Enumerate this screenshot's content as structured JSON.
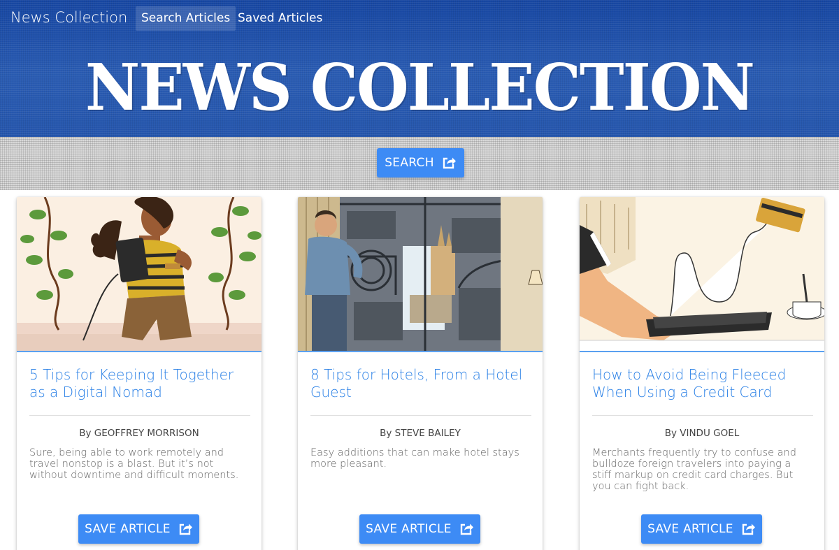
{
  "navbar": {
    "brand": "News Collection",
    "links": [
      {
        "label": "Search Articles",
        "active": true
      },
      {
        "label": "Saved Articles",
        "active": false
      }
    ]
  },
  "hero": {
    "title": "NEWS COLLECTION"
  },
  "search": {
    "button_label": "SEARCH",
    "icon": "share-square-icon"
  },
  "articles": [
    {
      "title": "5 Tips for Keeping It Together as a Digital Nomad",
      "author": "By GEOFFREY MORRISON",
      "summary": "Sure, being able to work remotely and travel nonstop is a blast. But it’s not without downtime and difficult moments.",
      "save_label": "SAVE ARTICLE",
      "image": "illustration-woman-with-vines"
    },
    {
      "title": "8 Tips for Hotels, From a Hotel Guest",
      "author": "By STEVE BAILEY",
      "summary": "Easy additions that can make hotel stays more pleasant.",
      "save_label": "SAVE ARTICLE",
      "image": "illustration-man-opening-curtain"
    },
    {
      "title": "How to Avoid Being Fleeced When Using a Credit Card",
      "author": "By VINDU GOEL",
      "summary": "Merchants frequently try to confuse and bulldoze foreign travelers into paying a stiff markup on credit card charges. But you can fight back.",
      "save_label": "SAVE ARTICLE",
      "image": "illustration-hand-with-receipt-tray"
    }
  ],
  "colors": {
    "header_blue": "#1f54ad",
    "button_blue": "#3d8bf5",
    "title_blue": "#2a80e6"
  }
}
